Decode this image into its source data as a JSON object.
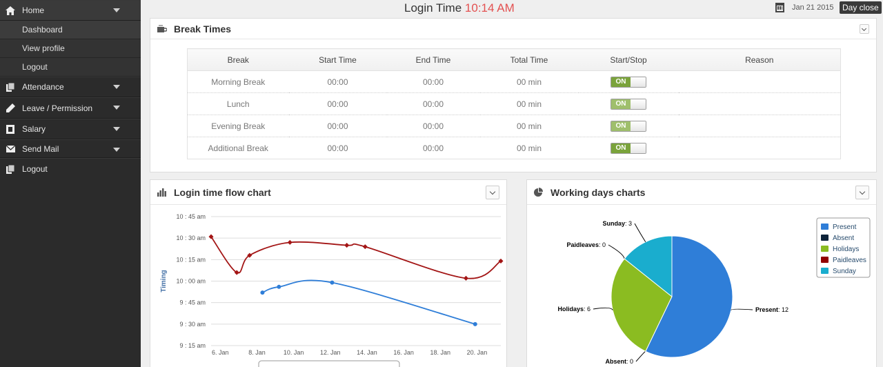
{
  "sidebar": {
    "home": {
      "label": "Home",
      "icon": "home-icon"
    },
    "sub_items": [
      "Dashboard",
      "View profile",
      "Logout"
    ],
    "items": [
      {
        "label": "Attendance",
        "icon": "attendance-icon"
      },
      {
        "label": "Leave / Permission",
        "icon": "pencil-icon"
      },
      {
        "label": "Salary",
        "icon": "salary-icon"
      },
      {
        "label": "Send Mail",
        "icon": "mail-icon"
      },
      {
        "label": "Logout",
        "icon": "logout-icon"
      }
    ]
  },
  "header": {
    "login_label": "Login Time",
    "login_time": "10:14 AM",
    "date": "Jan 21 2015",
    "day_close": "Day close"
  },
  "break_panel": {
    "title": "Break Times",
    "columns": [
      "Break",
      "Start Time",
      "End Time",
      "Total Time",
      "Start/Stop",
      "Reason"
    ],
    "rows": [
      {
        "break": "Morning Break",
        "start": "00:00",
        "end": "00:00",
        "total": "00 min",
        "toggle": "ON",
        "reason": ""
      },
      {
        "break": "Lunch",
        "start": "00:00",
        "end": "00:00",
        "total": "00 min",
        "toggle": "ON",
        "reason": ""
      },
      {
        "break": "Evening Break",
        "start": "00:00",
        "end": "00:00",
        "total": "00 min",
        "toggle": "ON",
        "reason": ""
      },
      {
        "break": "Additional Break",
        "start": "00:00",
        "end": "00:00",
        "total": "00 min",
        "toggle": "ON",
        "reason": ""
      }
    ]
  },
  "line_panel": {
    "title": "Login time flow chart"
  },
  "pie_panel": {
    "title": "Working days charts"
  },
  "chart_data": [
    {
      "type": "line",
      "title": "Login time flow chart",
      "ylabel": "Timing",
      "xlabel": "",
      "x_ticks": [
        "6. Jan",
        "8. Jan",
        "10. Jan",
        "12. Jan",
        "14. Jan",
        "16. Jan",
        "18. Jan",
        "20. Jan"
      ],
      "y_ticks": [
        "9 : 15 am",
        "9 : 30 am",
        "9 : 45 am",
        "10 : 00 am",
        "10 : 15 am",
        "10 : 30 am",
        "10 : 45 am"
      ],
      "ylim_minutes": [
        555,
        645
      ],
      "xlim_day": [
        5.5,
        21.3
      ],
      "series": [
        {
          "color": "#a31515",
          "points": [
            [
              5.5,
              631
            ],
            [
              6.9,
              606
            ],
            [
              7.6,
              618
            ],
            [
              9.8,
              627
            ],
            [
              12.9,
              625
            ],
            [
              13.9,
              624
            ],
            [
              19.4,
              602
            ],
            [
              21.3,
              614
            ]
          ]
        },
        {
          "color": "#2f7ed8",
          "points": [
            [
              8.3,
              592
            ],
            [
              9.2,
              596
            ],
            [
              12.1,
              599
            ],
            [
              19.9,
              570
            ]
          ]
        }
      ]
    },
    {
      "type": "pie",
      "title": "Working days charts",
      "slices": [
        {
          "label": "Present",
          "value": 12,
          "color": "#2f7ed8"
        },
        {
          "label": "Absent",
          "value": 0,
          "color": "#0d233a"
        },
        {
          "label": "Holidays",
          "value": 6,
          "color": "#8bbc21"
        },
        {
          "label": "Paidleaves",
          "value": 0,
          "color": "#910000"
        },
        {
          "label": "Sunday",
          "value": 3,
          "color": "#1aadce"
        }
      ],
      "legend": "top-right"
    }
  ]
}
